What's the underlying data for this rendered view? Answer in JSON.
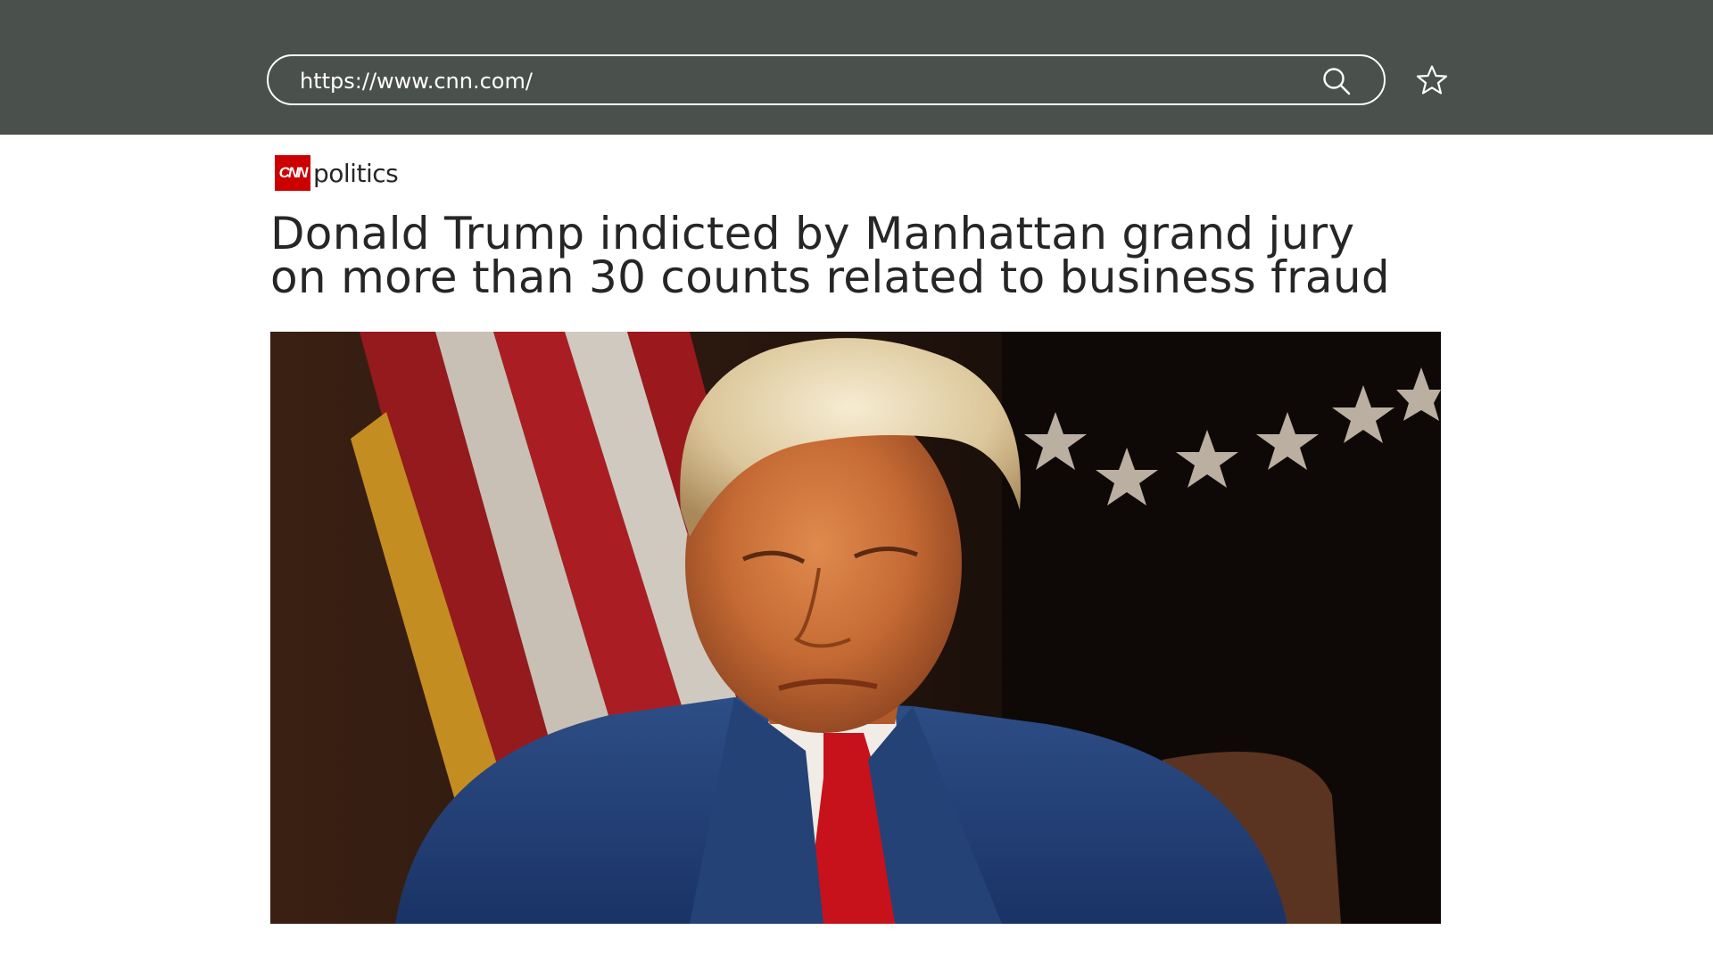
{
  "browser": {
    "url": "https://www.cnn.com/",
    "search_icon": "search-icon",
    "bookmark_icon": "star-icon"
  },
  "site": {
    "logo_text": "CNN",
    "section": "politics",
    "brand_color": "#cc0000"
  },
  "article": {
    "headline_line1": "Donald Trump indicted by Manhattan grand jury",
    "headline_line2": "on more than 30 counts related to business fraud",
    "hero_image": "photo"
  },
  "colors": {
    "toolbar": "#4a504b",
    "text": "#262626"
  }
}
